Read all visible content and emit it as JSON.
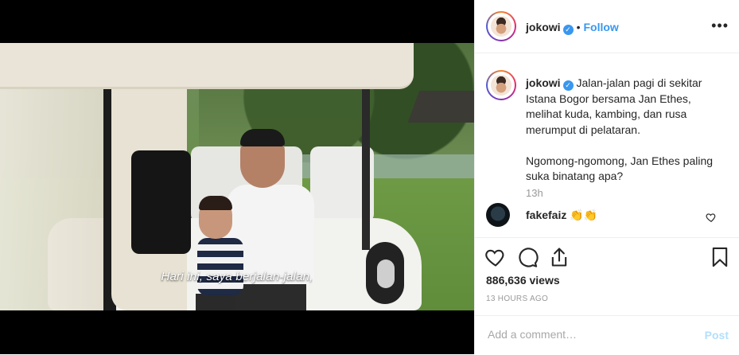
{
  "post": {
    "username": "jokowi",
    "follow_label": "Follow",
    "dot": "•",
    "more_label": "•••",
    "caption": {
      "username": "jokowi",
      "text": "Jalan-jalan pagi di sekitar Istana Bogor bersama Jan Ethes, melihat kuda, kambing, dan rusa merumput di pelataran.\n\nNgomong-ngomong, Jan Ethes paling suka binatang apa?"
    },
    "caption_time": "13h",
    "comment": {
      "username": "fakefaiz",
      "text": "👏👏"
    },
    "views": "886,636 views",
    "ago": "13 HOURS AGO",
    "add_comment_placeholder": "Add a comment…",
    "post_label": "Post",
    "video_subtitle": "Hari ini, saya berjalan-jalan,",
    "verified_mark": "✓"
  },
  "icons": {
    "like": "heart-icon",
    "comment": "comment-icon",
    "share": "share-icon",
    "save": "bookmark-icon",
    "more": "more-options-icon"
  },
  "colors": {
    "accent": "#3897f0",
    "post_disabled": "#b2dffc",
    "muted": "#999999"
  }
}
